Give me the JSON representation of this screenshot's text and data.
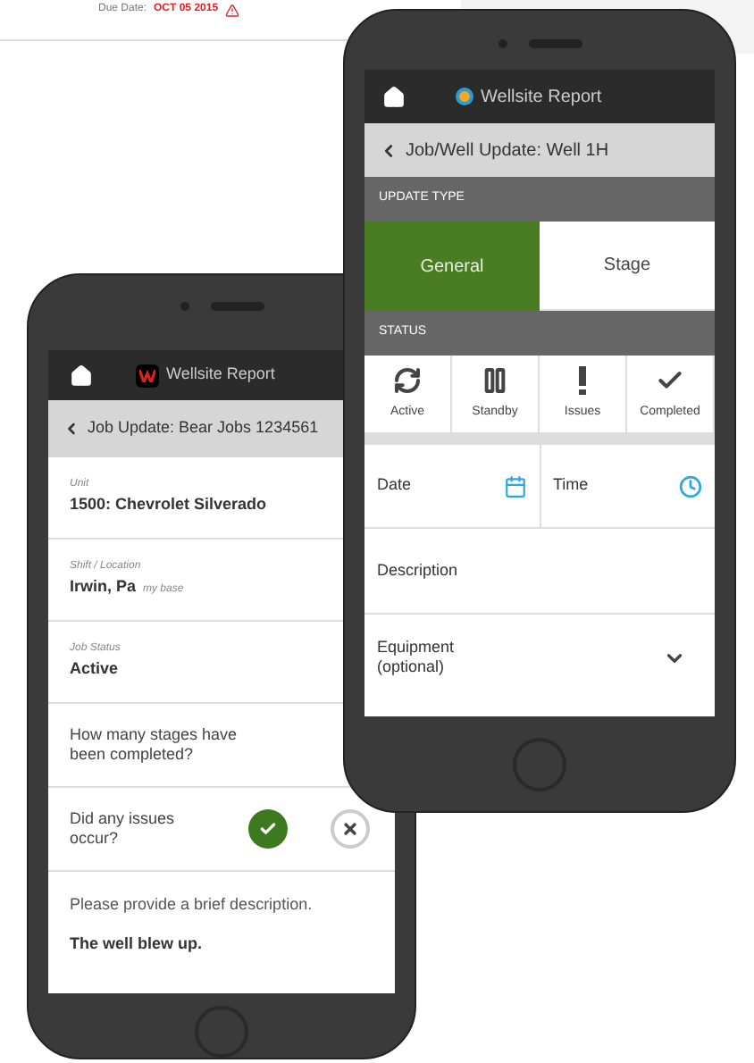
{
  "top_card": {
    "due_label": "Due Date:",
    "due_date": "OCT 05 2015"
  },
  "back_phone": {
    "header_title": "Wellsite Report",
    "back_title": "Job Update: Bear Jobs 1234561",
    "fields": [
      {
        "label": "Unit",
        "value": "1500: Chevrolet Silverado"
      },
      {
        "label": "Shift / Location",
        "value": "Irwin, Pa",
        "note": "my base"
      },
      {
        "label": "Job Status",
        "value": "Active"
      }
    ],
    "stages_question": "How many stages have been completed?",
    "issues_question": "Did any issues occur?",
    "answers": [
      {
        "kind": "yes",
        "selected": true
      },
      {
        "kind": "no",
        "selected": false
      }
    ],
    "description_prompt": "Please provide a brief description.",
    "description_value": "The well blew up."
  },
  "front_phone": {
    "header_title": "Wellsite Report",
    "back_title": "Job/Well Update: Well 1H",
    "update_type_label": "UPDATE TYPE",
    "tabs": [
      {
        "label": "General",
        "selected": true
      },
      {
        "label": "Stage",
        "selected": false
      }
    ],
    "status_label": "STATUS",
    "statuses": [
      {
        "label": "Active",
        "kind": "active"
      },
      {
        "label": "Standby",
        "kind": "standby"
      },
      {
        "label": "Issues",
        "kind": "issues"
      },
      {
        "label": "Completed",
        "kind": "completed"
      }
    ],
    "date_label": "Date",
    "time_label": "Time",
    "description_label": "Description",
    "equipment_label": "Equipment (optional)"
  }
}
